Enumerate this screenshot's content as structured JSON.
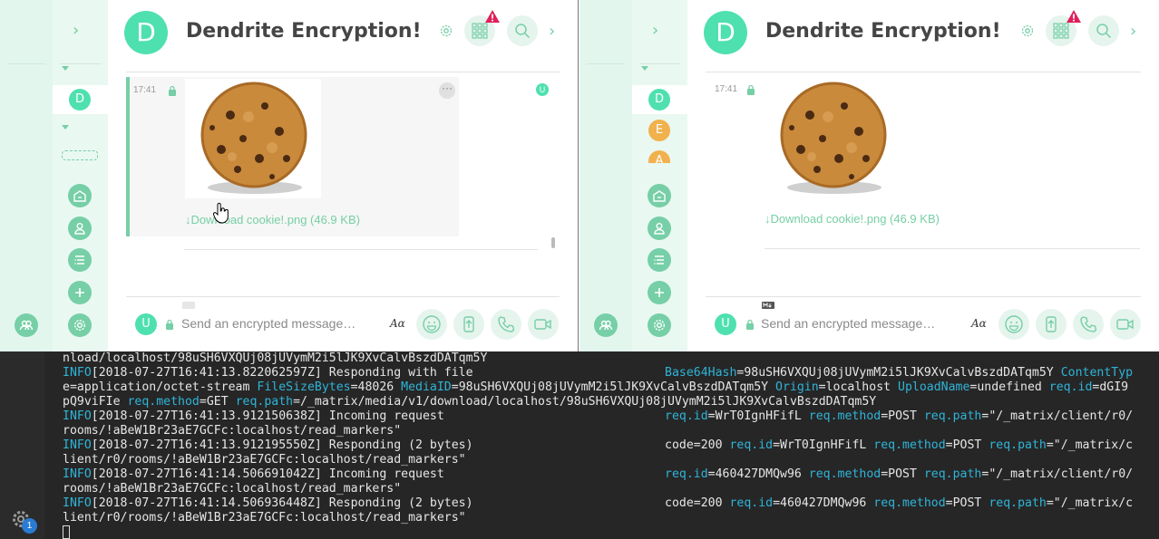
{
  "room": {
    "name": "Dendrite Encryption!",
    "avatar_letter": "D"
  },
  "sidebar": {
    "left_rooms": [
      "D"
    ],
    "right_rooms": [
      "D",
      "E",
      "A"
    ]
  },
  "message": {
    "time": "17:41",
    "download_label": "↓Download cookie!.png (46.9 KB)",
    "receipt_letter": "U",
    "options_glyph": "···"
  },
  "composer": {
    "placeholder": "Send an encrypted message…",
    "user_letter": "U",
    "format_label": "Aα"
  },
  "terminal": {
    "lines": [
      {
        "left": "nload/localhost/98uSH6VXQUj08jUVymM2i5lJK9XvCalvBszdDATqm5Y",
        "right": ""
      },
      {
        "left": "INFO[2018-07-27T16:41:13.822062597Z] Responding with file",
        "right_html": "<span class='k'>Base64Hash</span>=98uSH6VXQUj08jUVymM2i5lJK9XvCalvBszdDATqm5Y <span class='k'>ContentTyp</span>"
      },
      {
        "left_html": "e=application/octet-stream <span class='k'>FileSizeBytes</span>=48026 <span class='k'>MediaID</span>=98uSH6VXQUj08jUVymM2i5lJK9XvCalvBszdDATqm5Y <span class='k'>Origin</span>=localhost <span class='k'>UploadName</span>=undefined <span class='k'>req.id</span>=dGI9"
      },
      {
        "left_html": "pQ9viFIe <span class='k'>req.method</span>=GET <span class='k'>req.path</span>=/_matrix/media/v1/download/localhost/98uSH6VXQUj08jUVymM2i5lJK9XvCalvBszdDATqm5Y"
      },
      {
        "left": "INFO[2018-07-27T16:41:13.912150638Z] Incoming request",
        "right_html": "<span class='k'>req.id</span>=WrT0IgnHFifL <span class='k'>req.method</span>=POST <span class='k'>req.path</span>=\"/_matrix/client/r0/"
      },
      {
        "left": "rooms/!aBeW1Br23aE7GCFc:localhost/read_markers\"",
        "right": ""
      },
      {
        "left": "INFO[2018-07-27T16:41:13.912195550Z] Responding (2 bytes)",
        "right_html": "code=200 <span class='k'>req.id</span>=WrT0IgnHFifL <span class='k'>req.method</span>=POST <span class='k'>req.path</span>=\"/_matrix/c"
      },
      {
        "left": "lient/r0/rooms/!aBeW1Br23aE7GCFc:localhost/read_markers\"",
        "right": ""
      },
      {
        "left": "INFO[2018-07-27T16:41:14.506691042Z] Incoming request",
        "right_html": "<span class='k'>req.id</span>=460427DMQw96 <span class='k'>req.method</span>=POST <span class='k'>req.path</span>=\"/_matrix/client/r0/"
      },
      {
        "left": "rooms/!aBeW1Br23aE7GCFc:localhost/read_markers\"",
        "right": ""
      },
      {
        "left": "INFO[2018-07-27T16:41:14.506936448Z] Responding (2 bytes)",
        "right_html": "code=200 <span class='k'>req.id</span>=460427DMQw96 <span class='k'>req.method</span>=POST <span class='k'>req.path</span>=\"/_matrix/c"
      },
      {
        "left": "lient/r0/rooms/!aBeW1Br23aE7GCFc:localhost/read_markers\"",
        "right": ""
      }
    ],
    "badge_count": "1"
  },
  "colors": {
    "accent": "#76cfa6",
    "avatar": "#4fe0b0",
    "alert": "#e0205a",
    "terminal_bg": "#262626",
    "terminal_key": "#2fb4d8"
  },
  "icons": [
    "chevron-right-icon",
    "home-icon",
    "people-icon",
    "room-list-icon",
    "plus-icon",
    "group-icon",
    "settings-icon",
    "apps-grid-icon",
    "search-icon",
    "lock-icon",
    "emoji-icon",
    "upload-icon",
    "phone-icon",
    "video-icon",
    "markdown-icon"
  ]
}
